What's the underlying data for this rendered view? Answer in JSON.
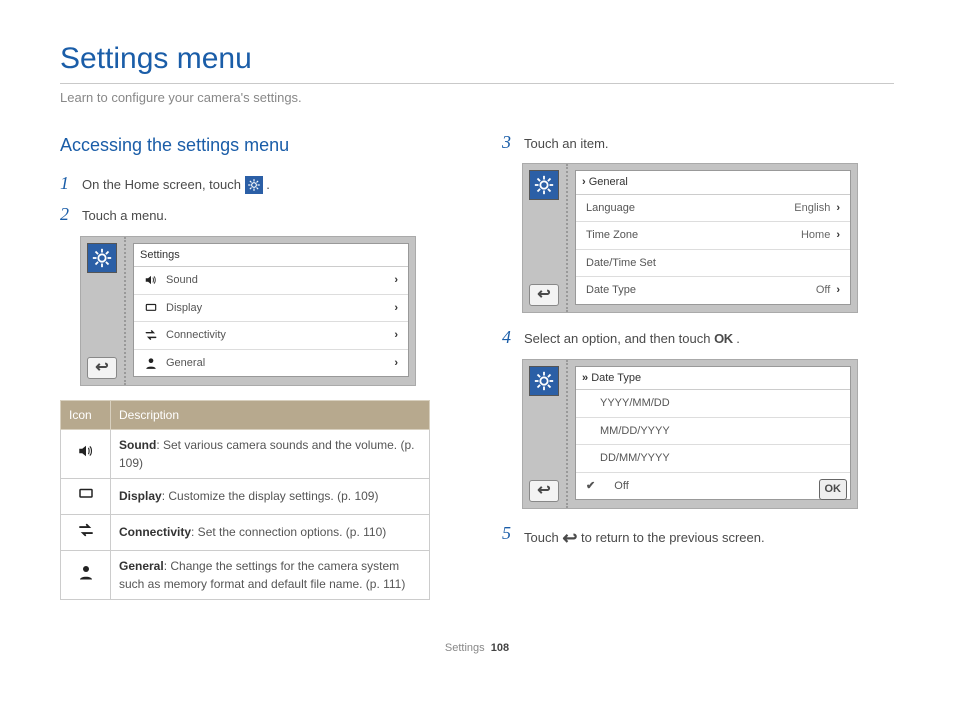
{
  "page_title": "Settings menu",
  "intro": "Learn to configure your camera's settings.",
  "section_heading": "Accessing the settings menu",
  "steps": {
    "s1": {
      "num": "1",
      "pre": "On the Home screen, touch ",
      "post": "."
    },
    "s2": {
      "num": "2",
      "text": "Touch a menu."
    },
    "s3": {
      "num": "3",
      "text": "Touch an item."
    },
    "s4": {
      "num": "4",
      "pre": "Select an option, and then touch ",
      "ok": "OK",
      "post": " ."
    },
    "s5": {
      "num": "5",
      "pre": "Touch ",
      "post": " to return to the previous screen."
    }
  },
  "screenshot1": {
    "title": "Settings",
    "rows": [
      {
        "label": "Sound"
      },
      {
        "label": "Display"
      },
      {
        "label": "Connectivity"
      },
      {
        "label": "General"
      }
    ]
  },
  "screenshot2": {
    "title": "General",
    "rows": [
      {
        "label": "Language",
        "value": "English"
      },
      {
        "label": "Time Zone",
        "value": "Home"
      },
      {
        "label": "Date/Time Set",
        "value": ""
      },
      {
        "label": "Date Type",
        "value": "Off"
      }
    ]
  },
  "screenshot3": {
    "title": "Date Type",
    "rows": [
      {
        "label": "YYYY/MM/DD"
      },
      {
        "label": "MM/DD/YYYY"
      },
      {
        "label": "DD/MM/YYYY"
      },
      {
        "label": "Off",
        "checked": true
      }
    ],
    "ok": "OK"
  },
  "table": {
    "headers": {
      "icon": "Icon",
      "desc": "Description"
    },
    "rows": [
      {
        "name": "Sound",
        "desc": ": Set various camera sounds and the volume. (p. 109)"
      },
      {
        "name": "Display",
        "desc": ": Customize the display settings. (p. 109)"
      },
      {
        "name": "Connectivity",
        "desc": ": Set the connection options. (p. 110)"
      },
      {
        "name": "General",
        "desc": ": Change the settings for the camera system such as memory format and default file name. (p. 111)"
      }
    ]
  },
  "footer": {
    "label": "Settings",
    "page": "108"
  }
}
